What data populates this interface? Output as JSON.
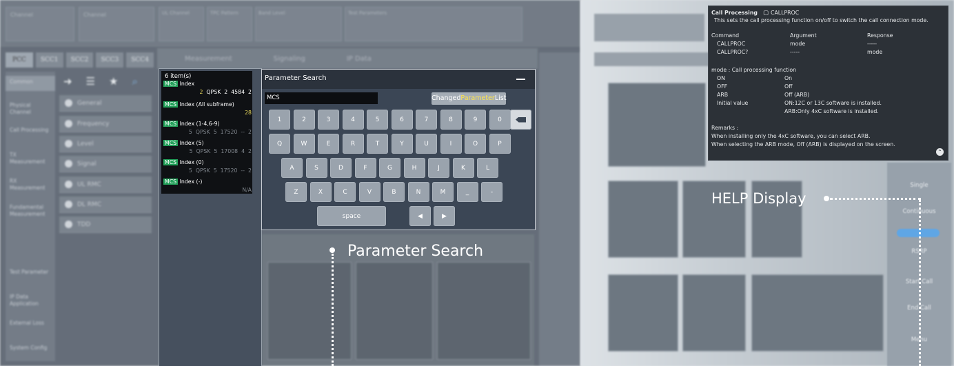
{
  "background_left": {
    "top_labels": [
      "Channel",
      "Channel",
      "UL Channel",
      "TPC Pattern",
      "Band Level",
      "Test Parameters"
    ],
    "cell_tabs": [
      "PCC",
      "SCC1",
      "SCC2",
      "SCC3",
      "SCC4"
    ],
    "nav_items": [
      "Common",
      "Physical Channel",
      "Call Processing",
      "TX Measurement",
      "RX Measurement",
      "Fundamental Measurement",
      "Test Parameter",
      "IP Data Application",
      "External Loss",
      "System Config"
    ],
    "sub_items": [
      "General",
      "Frequency",
      "Level",
      "Signal",
      "UL RMC",
      "DL RMC",
      "TDD"
    ],
    "mid_tabs": [
      "Measurement",
      "Signaling",
      "IP Data"
    ]
  },
  "results": {
    "count": "6 item(s)",
    "tag": "MCS",
    "items": [
      {
        "name": "Index",
        "sub": [
          "2",
          "QPSK",
          "2",
          "4584",
          "2"
        ],
        "sub_style": "mixed"
      },
      {
        "name": "Index (All subframe)",
        "sub": [
          "28"
        ],
        "sub_style": "yellow"
      },
      {
        "name": "Index (1-4,6-9)",
        "sub": [
          "5",
          "QPSK",
          "5",
          "17520",
          "--",
          "2"
        ],
        "sub_style": "dim"
      },
      {
        "name": "Index (5)",
        "sub": [
          "5",
          "QPSK",
          "5",
          "17008",
          "4",
          "2"
        ],
        "sub_style": "dim"
      },
      {
        "name": "Index (0)",
        "sub": [
          "5",
          "QPSK",
          "5",
          "17520",
          "--",
          "2"
        ],
        "sub_style": "dim"
      },
      {
        "name": "Index (-)",
        "sub": [
          "N/A"
        ],
        "sub_style": "dim"
      }
    ]
  },
  "search": {
    "title": "Parameter Search",
    "query": "MCS",
    "changed_prefix": "Changed",
    "changed_highlight": "Parameter",
    "changed_suffix": "List",
    "keys_row1": [
      "1",
      "2",
      "3",
      "4",
      "5",
      "6",
      "7",
      "8",
      "9",
      "0"
    ],
    "keys_row2": [
      "Q",
      "W",
      "E",
      "R",
      "T",
      "Y",
      "U",
      "I",
      "O",
      "P"
    ],
    "keys_row3": [
      "A",
      "S",
      "D",
      "F",
      "G",
      "H",
      "J",
      "K",
      "L"
    ],
    "keys_row4": [
      "Z",
      "X",
      "C",
      "V",
      "B",
      "N",
      "M",
      "_",
      "-"
    ],
    "space_label": "space",
    "left_arrow": "◀",
    "right_arrow": "▶"
  },
  "help": {
    "title": "Call Processing",
    "title_cmd": "CALLPROC",
    "desc": "This sets the call processing function on/off to switch the call connection mode.",
    "headers": [
      "Command",
      "Argument",
      "Response"
    ],
    "rows": [
      [
        "CALLPROC",
        "mode",
        "-----"
      ],
      [
        "CALLPROC?",
        "-----",
        "mode"
      ]
    ],
    "mode_heading": "mode : Call processing function",
    "mode_rows": [
      [
        "ON",
        "On"
      ],
      [
        "OFF",
        "Off"
      ],
      [
        "ARB",
        "Off (ARB)"
      ],
      [
        "Initial value",
        "ON:12C or 13C software is installed."
      ],
      [
        "",
        "ARB:Only 4xC software is installed."
      ]
    ],
    "remarks_heading": "Remarks :",
    "remarks": [
      "When installing only the 4xC software, you can select ARB.",
      "When selecting the ARB mode, Off (ARB) is displayed on the screen."
    ]
  },
  "right_menu": [
    "Single",
    "Continuous",
    "RSRP",
    "Start Call",
    "End Call",
    "Menu"
  ],
  "callouts": {
    "parameter_search": "Parameter Search",
    "help_display": "HELP Display"
  },
  "colors": {
    "accent_green": "#23a15a",
    "highlight_yellow": "#ffe54d",
    "help_bg": "#2c3137",
    "modal_bg": "#3b4655"
  }
}
